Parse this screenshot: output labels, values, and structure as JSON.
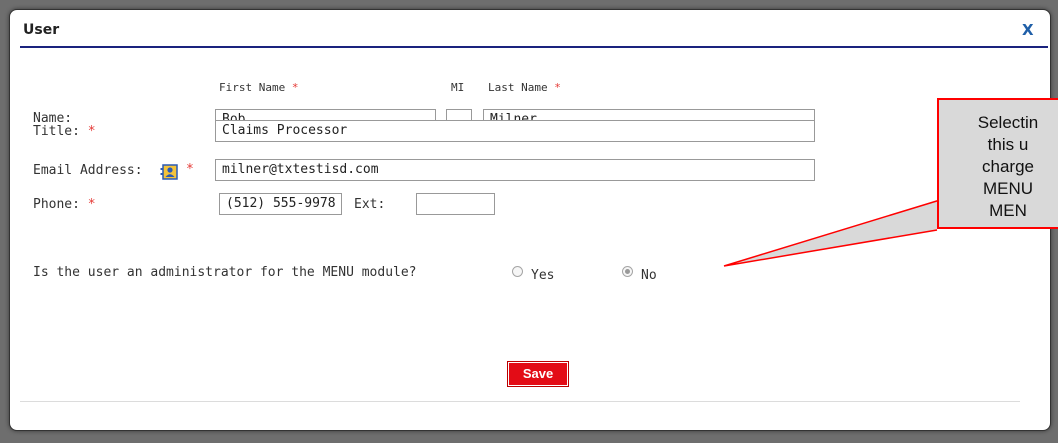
{
  "dialog": {
    "title": "User",
    "close_label": "X"
  },
  "form": {
    "headers": {
      "first_name": "First Name",
      "mi": "MI",
      "last_name": "Last Name",
      "required_mark": "*"
    },
    "name": {
      "label": "Name:",
      "first_name_value": "Bob",
      "mi_value": "",
      "last_name_value": "Milner"
    },
    "title": {
      "label": "Title:",
      "value": "Claims Processor"
    },
    "email": {
      "label": "Email Address:",
      "value": "milner@txtestisd.com"
    },
    "phone": {
      "label": "Phone:",
      "value": "(512) 555-9978",
      "ext_label": "Ext:",
      "ext_value": ""
    },
    "admin_question": {
      "label": "Is the user an administrator for the MENU module?",
      "yes_label": "Yes",
      "no_label": "No",
      "selected": "No"
    },
    "save_label": "Save"
  },
  "callout": {
    "lines": [
      "Selectin",
      "this u",
      "charge",
      "MENU",
      "MEN"
    ]
  },
  "colors": {
    "accent_rule": "#1a237e",
    "close": "#1f5fa8",
    "required": "#e53935",
    "save_button": "#e30c16",
    "callout_border": "#ff0000",
    "callout_fill": "#d9d9d9"
  }
}
